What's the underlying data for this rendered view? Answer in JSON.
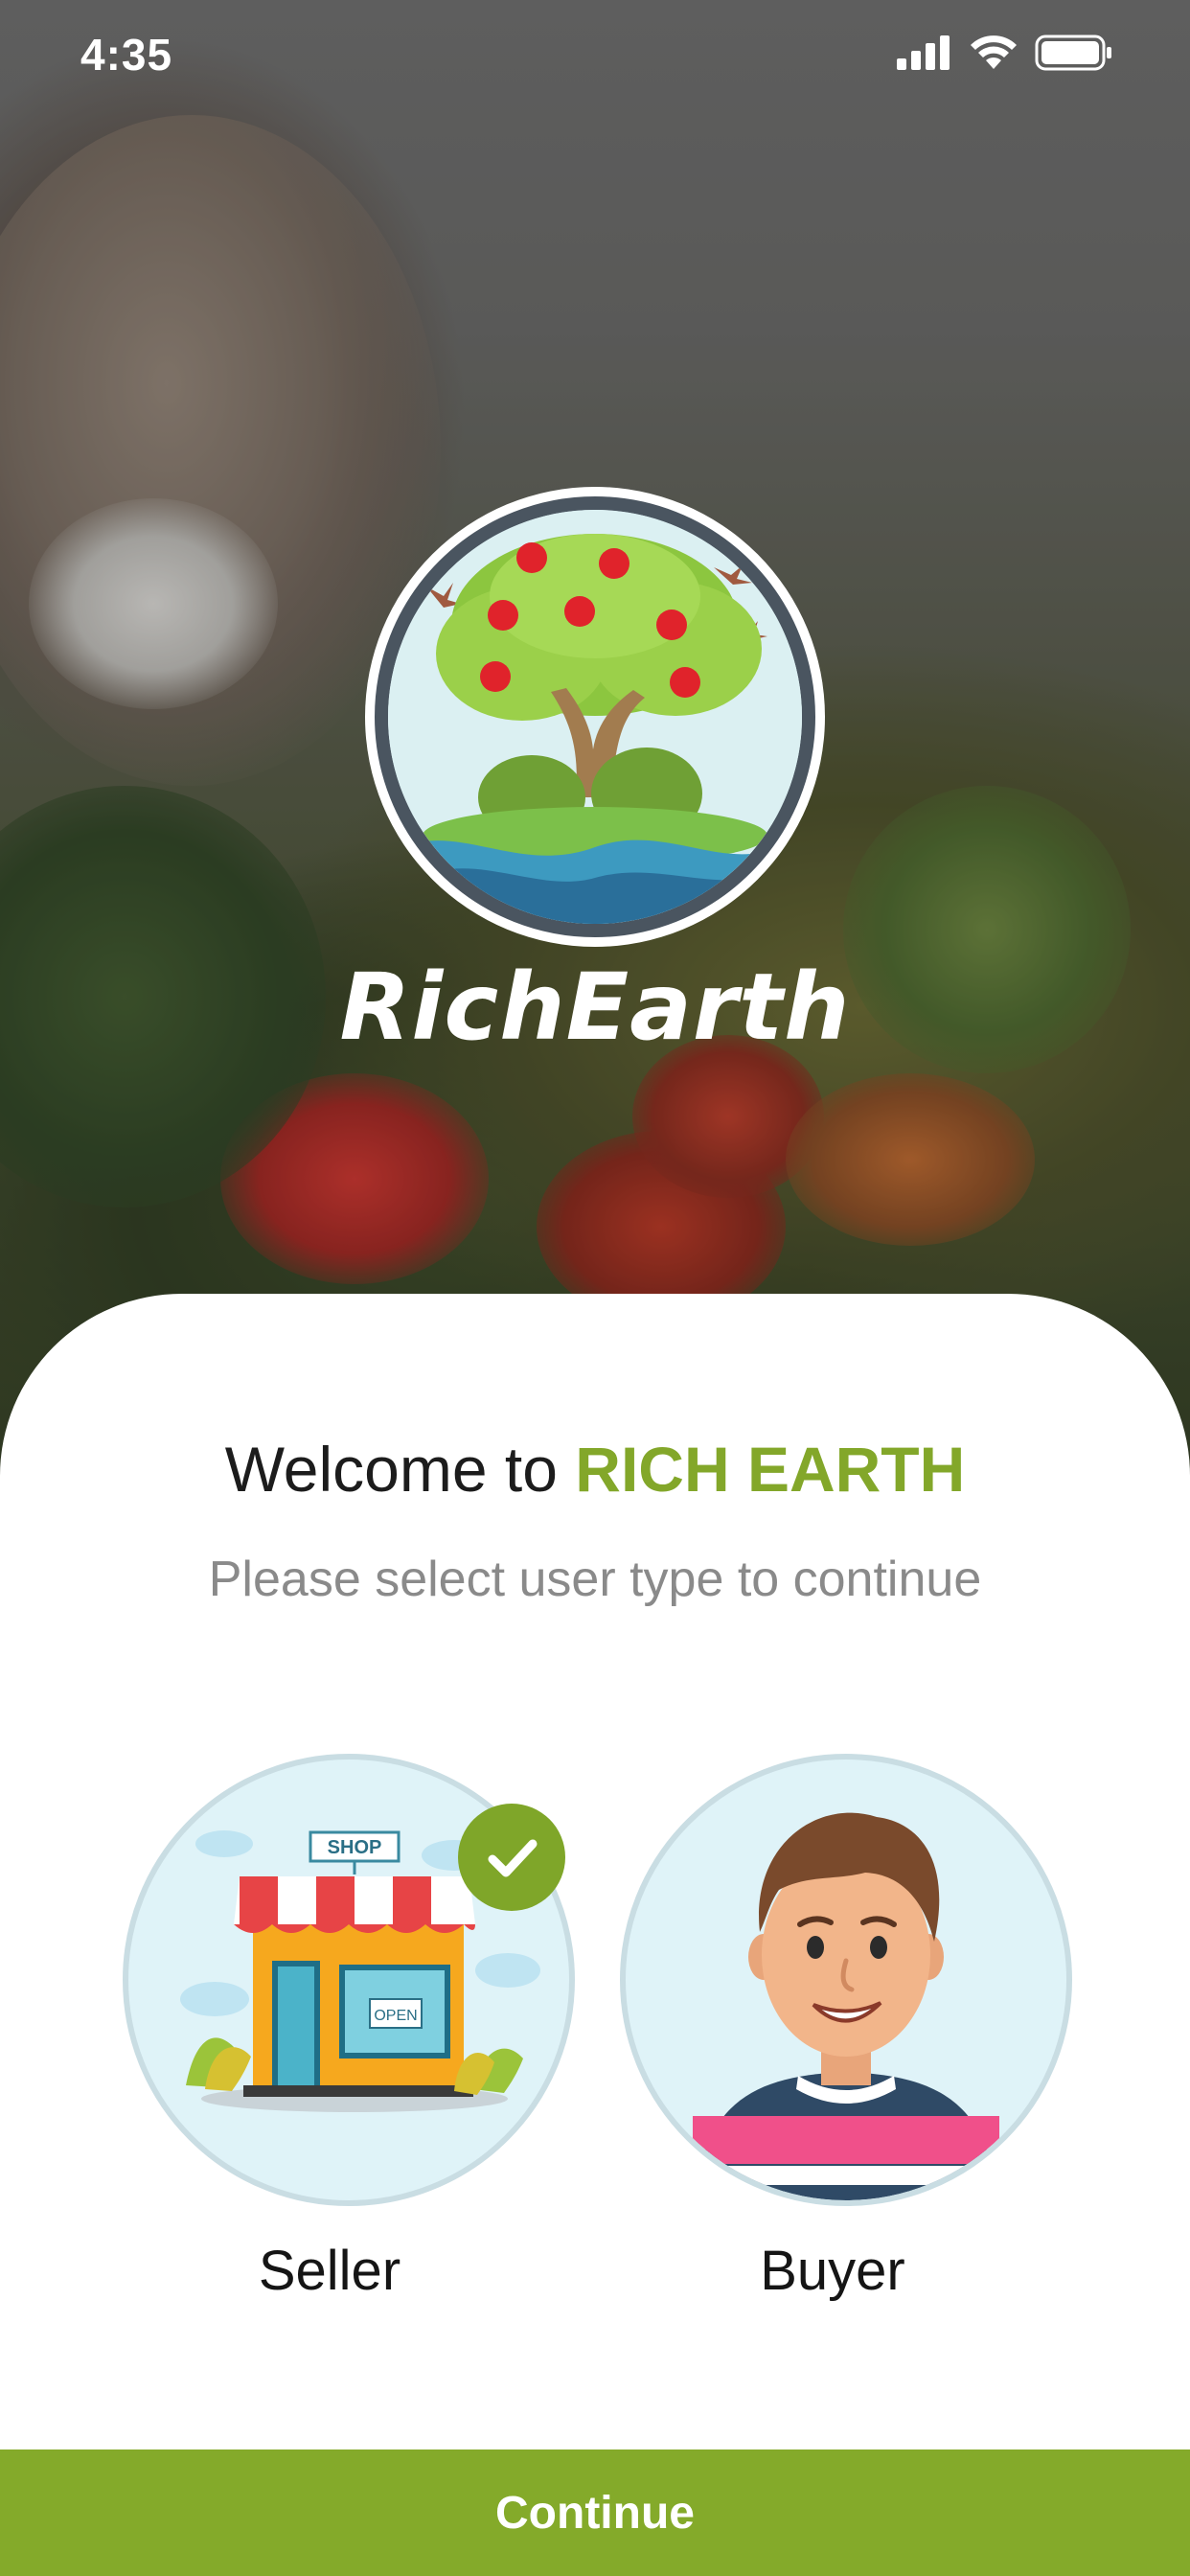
{
  "status_bar": {
    "time": "4:35",
    "icons": [
      "signal-icon",
      "wifi-icon",
      "battery-icon"
    ]
  },
  "brand": {
    "name": "RichEarth",
    "logo_icon": "apple-tree-logo-icon"
  },
  "welcome": {
    "prefix": "Welcome to ",
    "highlight": "RICH EARTH",
    "subtitle": "Please select user type to continue"
  },
  "options": [
    {
      "label": "Seller",
      "icon": "shop-icon",
      "shop_sign": "SHOP",
      "door_sign": "OPEN",
      "selected": true
    },
    {
      "label": "Buyer",
      "icon": "buyer-avatar-icon",
      "selected": false
    }
  ],
  "continue_button": {
    "label": "Continue"
  },
  "colors": {
    "accent": "#84aa2a",
    "welcome_text": "#1c1c1c",
    "subtitle_text": "#8a8a8a",
    "option_background": "#dff3f8"
  }
}
